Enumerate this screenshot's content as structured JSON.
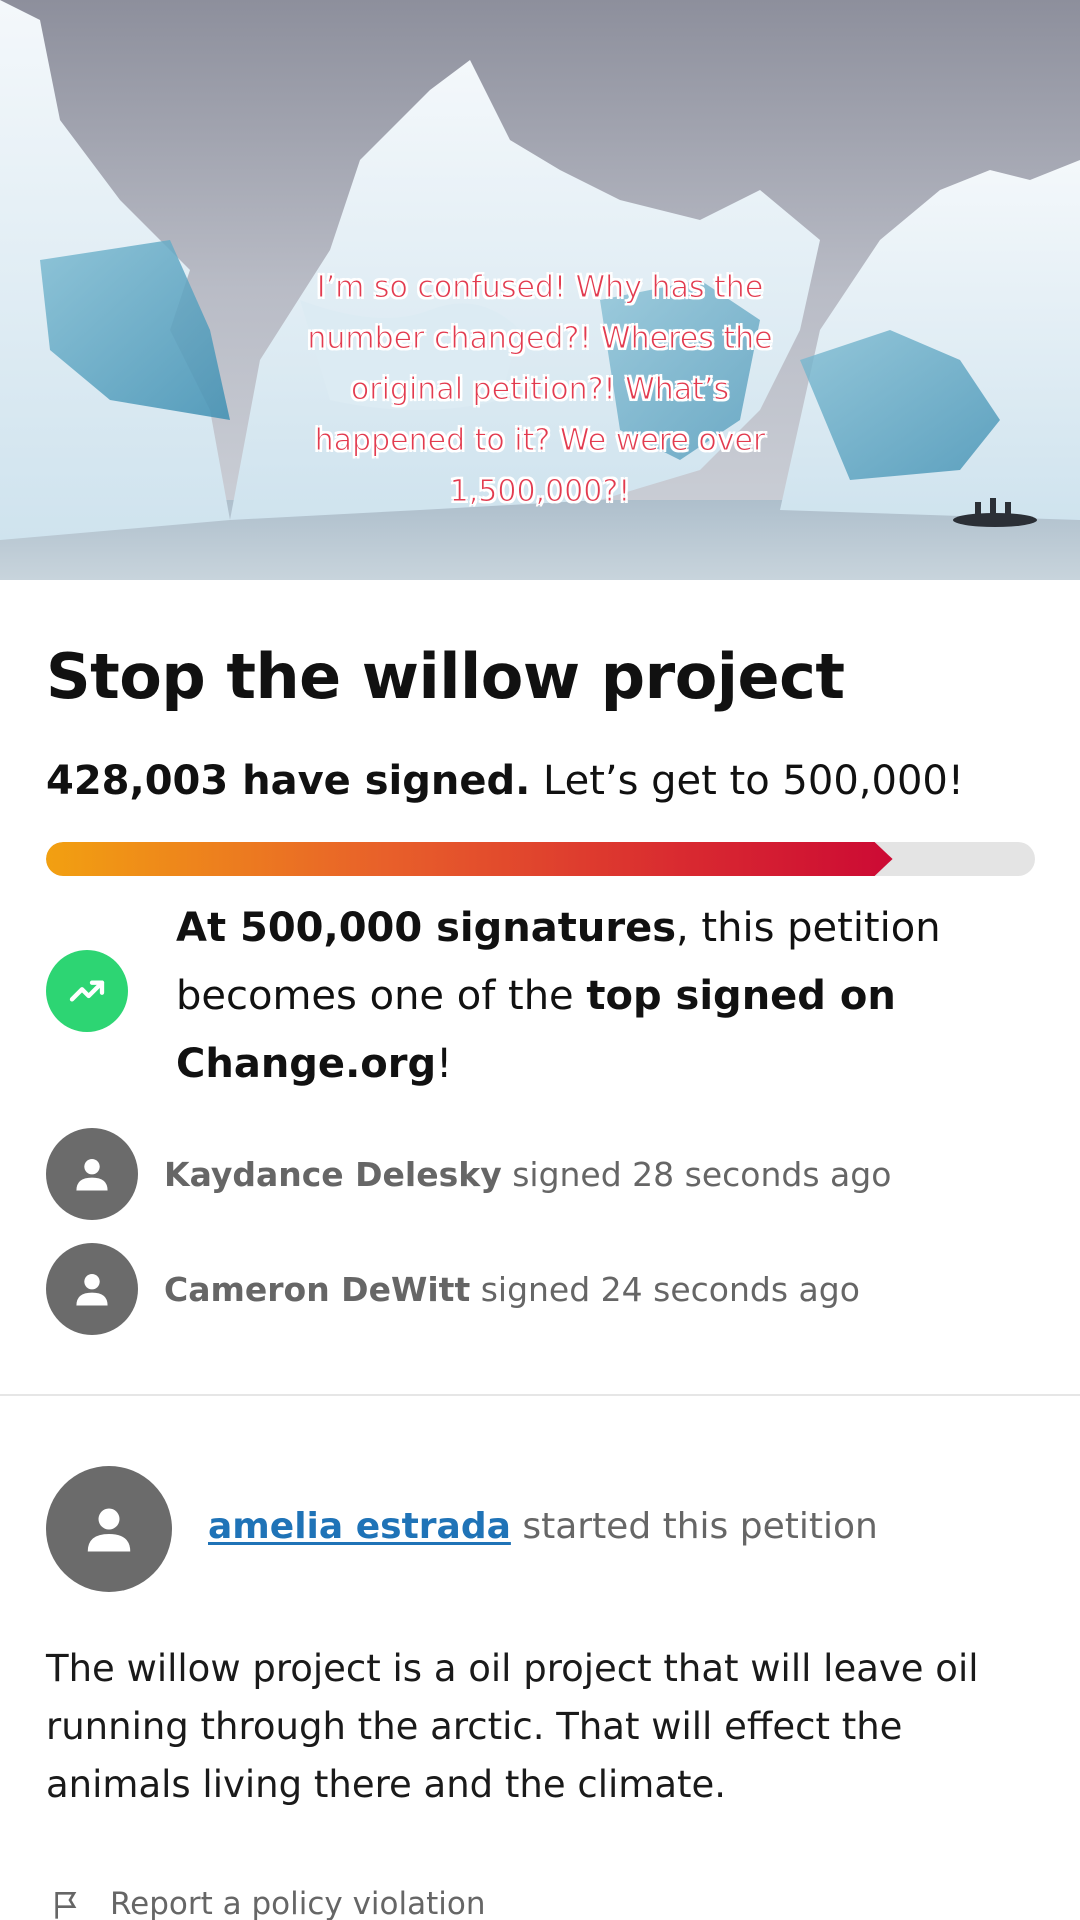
{
  "overlay_caption": "I’m so confused! Why has the number changed?! Wheres the original petition?! What’s happened to it? We were over 1,500,000?!",
  "petition": {
    "title": "Stop the willow project",
    "signed_count": "428,003 have signed.",
    "goal_text": " Let’s get to 500,000!",
    "progress_fraction": 0.856
  },
  "milestone": {
    "icon": "trending-up-icon",
    "bold1": "At 500,000 signatures",
    "text1": ", this petition becomes one of the ",
    "bold2": "top signed on Change.org",
    "text2": "!"
  },
  "recent_signers": [
    {
      "name": "Kaydance Delesky",
      "action": " signed 28 seconds ago"
    },
    {
      "name": "Cameron DeWitt",
      "action": " signed 24 seconds ago"
    }
  ],
  "starter": {
    "name": "amelia estrada",
    "action": " started this petition"
  },
  "description": "The willow project is a oil project that will leave oil running through the arctic. That will effect the animals living there and the climate.",
  "report_label": "Report a policy violation",
  "colors": {
    "progress_start": "#f2a011",
    "progress_end": "#cc0a34",
    "milestone_icon_bg": "#2dd573",
    "link": "#1f73b7",
    "caption": "#e23b4f"
  }
}
